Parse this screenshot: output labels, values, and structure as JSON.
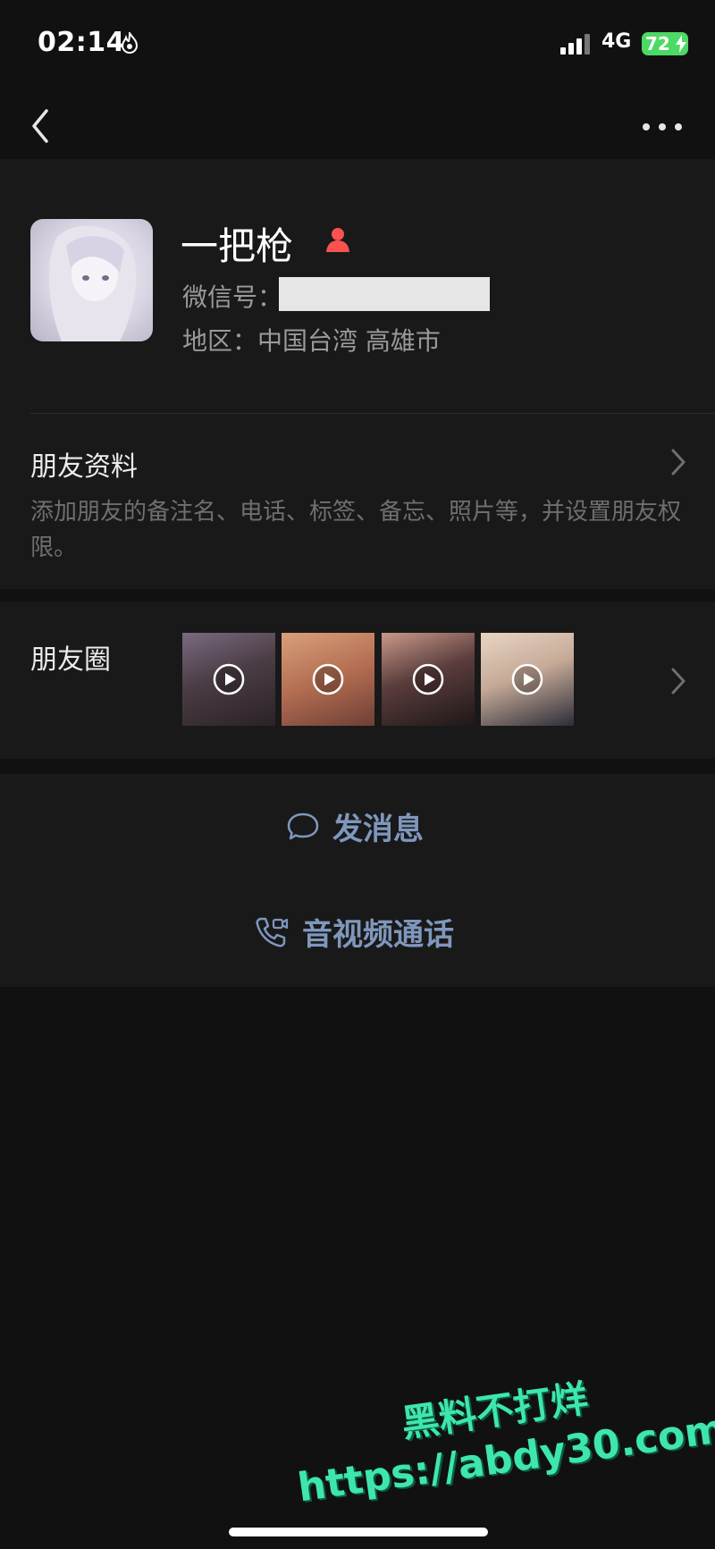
{
  "status_bar": {
    "time": "02:14",
    "network": "4G",
    "battery_percent": "72"
  },
  "profile": {
    "name": "一把枪",
    "wechat_id_label": "微信号：",
    "region_label": "地区：中国台湾 高雄市",
    "gender_icon": "female-icon",
    "gender_color": "#fa5151"
  },
  "friend_info": {
    "title": "朋友资料",
    "description": "添加朋友的备注名、电话、标签、备忘、照片等，并设置朋友权限。"
  },
  "moments": {
    "title": "朋友圈",
    "thumbnails": [
      {
        "icon": "video-play-icon",
        "color": "#5a4a52"
      },
      {
        "icon": "video-play-icon",
        "color": "#b06a50"
      },
      {
        "icon": "video-play-icon",
        "color": "#3a2a2c"
      },
      {
        "icon": "video-play-icon",
        "color": "#c7b6ac"
      }
    ]
  },
  "actions": {
    "message_label": "发消息",
    "call_label": "音视频通话",
    "accent_color": "#7f97bd"
  },
  "watermark": {
    "line1": "黑料不打烊",
    "line2": "https://abdy30.com"
  }
}
